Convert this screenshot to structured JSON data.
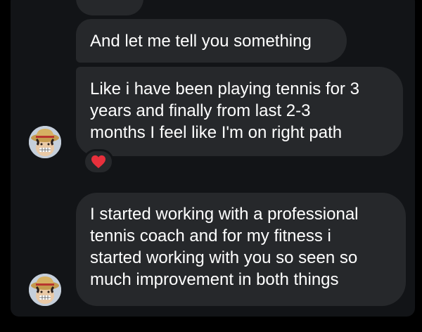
{
  "conversation": {
    "messages": [
      {
        "lines": [
          "And let me tell you something"
        ]
      },
      {
        "lines": [
          "Like i have been playing tennis for 3",
          "years and finally from last 2-3",
          "months I feel like I'm on right path"
        ],
        "reaction": "heart-icon"
      },
      {
        "lines": [
          "I started working with a professional",
          "tennis coach and for my fitness i",
          "started working with you so seen so",
          "much improvement in both things"
        ]
      }
    ]
  },
  "colors": {
    "background": "#000000",
    "panel": "#121417",
    "bubble": "#26282b",
    "text": "#ffffff",
    "reaction_heart": "#e8303c"
  }
}
